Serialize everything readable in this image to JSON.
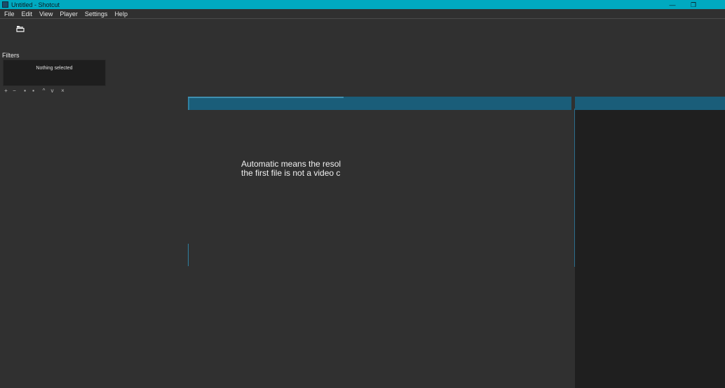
{
  "window": {
    "title": "Untitled - Shotcut",
    "controls": {
      "minimize": "—",
      "restore": "❐",
      "close": ""
    }
  },
  "menu": [
    "File",
    "Edit",
    "View",
    "Player",
    "Settings",
    "Help"
  ],
  "toolbar": {
    "open_icon": "folder-open-icon"
  },
  "filters": {
    "title": "Filters",
    "empty_text": "Nothing selected",
    "buttons": [
      {
        "icon": "add-icon",
        "glyph": "+"
      },
      {
        "icon": "remove-icon",
        "glyph": "−"
      },
      {
        "icon": "copy-icon",
        "glyph": "▪"
      },
      {
        "icon": "paste-icon",
        "glyph": "▪"
      },
      {
        "icon": "move-up-icon",
        "glyph": "^"
      },
      {
        "icon": "move-down-icon",
        "glyph": "v"
      },
      {
        "icon": "deselect-icon",
        "glyph": "×"
      }
    ]
  },
  "player": {
    "note_line1": "Automatic means the resolution",
    "note_line2": "the first file is not a video clip ("
  },
  "colors": {
    "title_bar": "#00a9c0",
    "panel_tab": "#1a5d79",
    "background": "#303030",
    "dock_background": "#1f1f1f"
  }
}
